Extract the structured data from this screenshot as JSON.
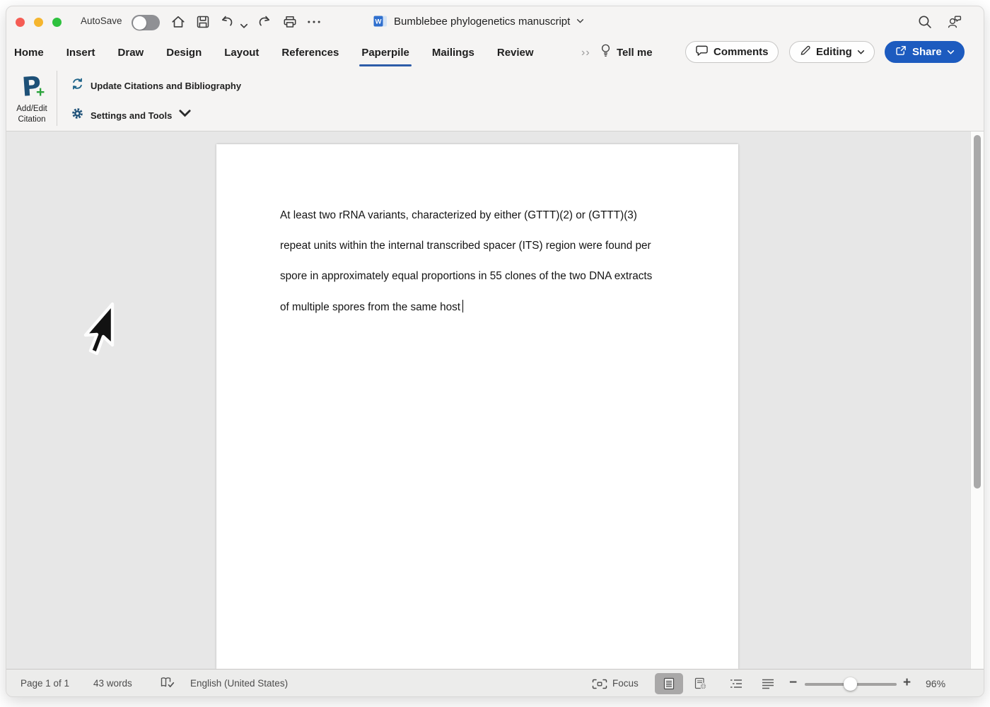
{
  "titlebar": {
    "autosave_label": "AutoSave",
    "autosave_state": "off",
    "document_title": "Bumblebee phylogenetics manuscript",
    "icons": [
      "close-window-icon",
      "minimize-window-icon",
      "zoom-window-icon",
      "home-icon",
      "save-icon",
      "undo-icon",
      "redo-icon",
      "print-icon",
      "more-icon",
      "word-doc-icon",
      "search-icon",
      "presence-icon"
    ]
  },
  "tabs": {
    "items": [
      {
        "label": "Home"
      },
      {
        "label": "Insert"
      },
      {
        "label": "Draw"
      },
      {
        "label": "Design"
      },
      {
        "label": "Layout"
      },
      {
        "label": "References"
      },
      {
        "label": "Paperpile"
      },
      {
        "label": "Mailings"
      },
      {
        "label": "Review"
      }
    ],
    "active_tab": "Paperpile",
    "overflow_label": "››",
    "tell_me_label": "Tell me"
  },
  "actions": {
    "comments_label": "Comments",
    "editing_label": "Editing",
    "share_label": "Share"
  },
  "ribbon": {
    "logo_letter": "P",
    "logo_plus": "+",
    "add_edit_line1": "Add/Edit",
    "add_edit_line2": "Citation",
    "update_citations_label": "Update Citations and Bibliography",
    "settings_tools_label": "Settings and Tools"
  },
  "document": {
    "paragraph_lines": [
      "At least two rRNA variants, characterized by either (GTTT)(2) or (GTTT)(3)",
      "repeat units within the internal transcribed spacer (ITS) region were found per",
      "spore in approximately equal proportions in 55 clones of the two DNA extracts",
      "of multiple spores from the same host"
    ]
  },
  "statusbar": {
    "page_indicator": "Page 1 of 1",
    "word_count": "43 words",
    "language": "English (United States)",
    "focus_label": "Focus",
    "views": [
      "print-layout",
      "web-layout",
      "outline",
      "draft"
    ],
    "active_view": "print-layout",
    "zoom_level": "96%"
  },
  "colors": {
    "share_button_blue": "#1d5bbf",
    "tab_underline_blue": "#2d5ca8",
    "paperpile_navy": "#1d5077",
    "paperpile_green": "#2ba33c",
    "ribbon_icon_blue": "#1c6288",
    "doc_background": "#e7e7e7"
  }
}
